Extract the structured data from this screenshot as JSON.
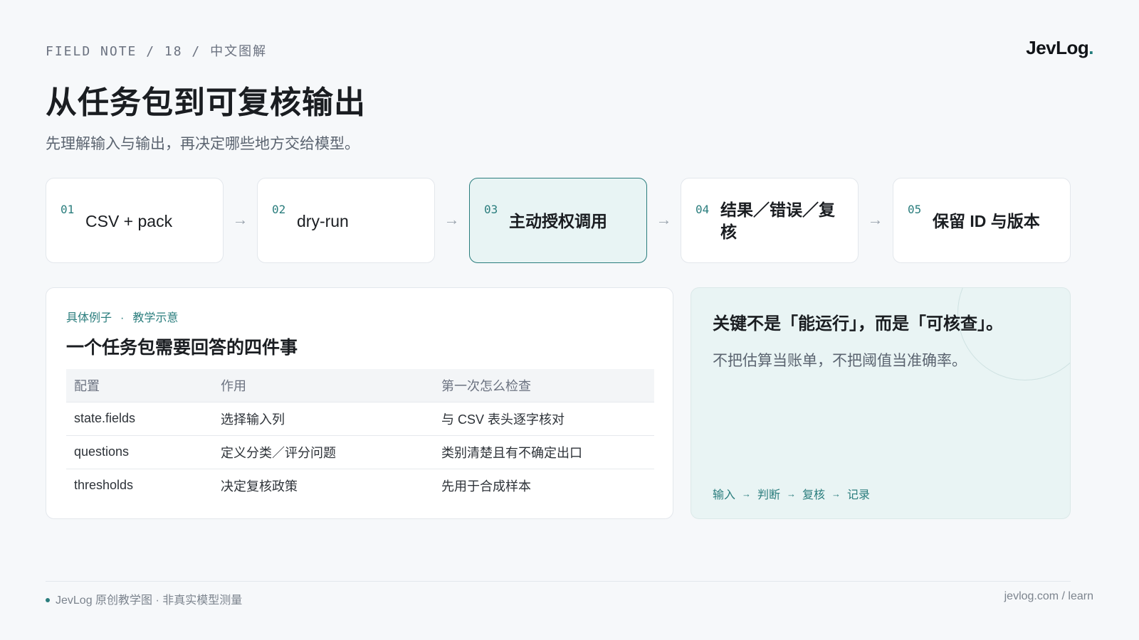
{
  "header": {
    "kicker": "FIELD NOTE / 18 / 中文图解",
    "logo_text": "JevLog",
    "logo_dot": ".",
    "title": "从任务包到可复核输出",
    "subtitle": "先理解输入与输出，再决定哪些地方交给模型。"
  },
  "steps": [
    {
      "num": "01",
      "label": "CSV + pack",
      "active": false
    },
    {
      "num": "02",
      "label": "dry-run",
      "active": false
    },
    {
      "num": "03",
      "label": "主动授权调用",
      "active": true
    },
    {
      "num": "04",
      "label": "结果／错误／复核",
      "active": false
    },
    {
      "num": "05",
      "label": "保留 ID 与版本",
      "active": false
    }
  ],
  "step_arrow": "→",
  "example": {
    "tag_left": "具体例子",
    "tag_sep": "·",
    "tag_right": "教学示意",
    "heading": "一个任务包需要回答的四件事",
    "columns": [
      "配置",
      "作用",
      "第一次怎么检查"
    ],
    "rows": [
      [
        "state.fields",
        "选择输入列",
        "与 CSV 表头逐字核对"
      ],
      [
        "questions",
        "定义分类／评分问题",
        "类别清楚且有不确定出口"
      ],
      [
        "thresholds",
        "决定复核政策",
        "先用于合成样本"
      ]
    ]
  },
  "callout": {
    "title": "关键不是「能运行」，而是「可核查」。",
    "text": "不把估算当账单，不把阈值当准确率。",
    "flow": [
      "输入",
      "判断",
      "复核",
      "记录"
    ],
    "flow_arrow": "→"
  },
  "footer": {
    "left": "JevLog 原创教学图 · 非真实模型测量",
    "right": "jevlog.com / learn"
  },
  "colors": {
    "accent": "#2a7d7d",
    "active_bg": "#e8f4f4",
    "page_bg": "#f6f8fa"
  }
}
